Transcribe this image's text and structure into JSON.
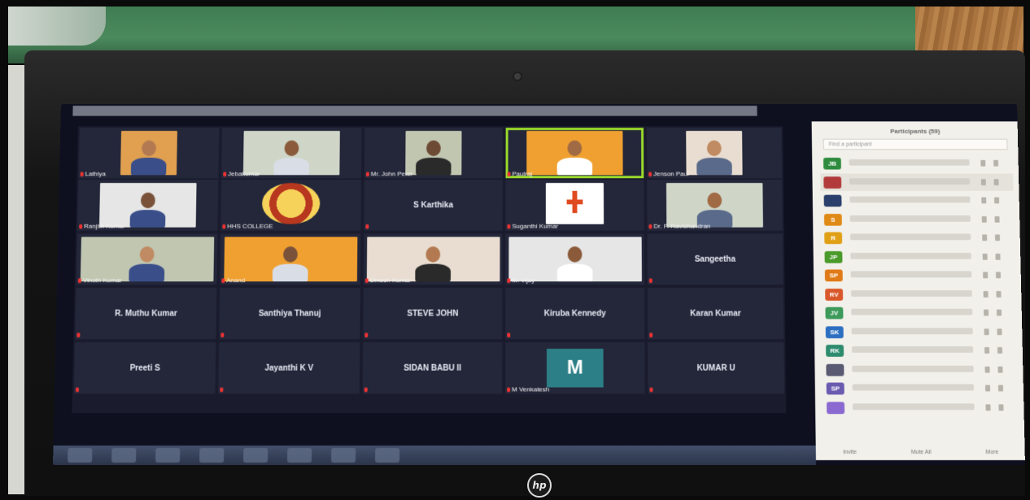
{
  "meeting": {
    "view_label": "",
    "participants_panel_title": "Participants (59)",
    "search_placeholder": "Find a participant",
    "panel_footer": [
      "Invite",
      "Mute All",
      "More"
    ]
  },
  "tiles": [
    {
      "id": "t1",
      "name": "Lathiya",
      "kind": "video",
      "active": false
    },
    {
      "id": "t2",
      "name": "Jebakumar",
      "kind": "video",
      "active": false
    },
    {
      "id": "t3",
      "name": "Mr. John Peter",
      "kind": "video",
      "active": false
    },
    {
      "id": "t4",
      "name": "Paulraj",
      "kind": "video",
      "active": true
    },
    {
      "id": "t5",
      "name": "Jenson Paul",
      "kind": "video",
      "active": false
    },
    {
      "id": "t6",
      "name": "Ranjith Kumar",
      "kind": "video",
      "active": false
    },
    {
      "id": "t7",
      "name": "HHS COLLEGE",
      "kind": "logo",
      "active": false
    },
    {
      "id": "t8",
      "name": "S Karthika",
      "kind": "text",
      "active": false
    },
    {
      "id": "t9",
      "name": "Suganthi Kumar",
      "kind": "logo",
      "active": false
    },
    {
      "id": "t10",
      "name": "Dr. P. Ravichandran",
      "kind": "video",
      "active": false
    },
    {
      "id": "t11",
      "name": "Vinoth Kumar",
      "kind": "video",
      "active": false
    },
    {
      "id": "t12",
      "name": "Anand",
      "kind": "video",
      "active": false
    },
    {
      "id": "t13",
      "name": "Dinesh Kumar",
      "kind": "video",
      "active": false
    },
    {
      "id": "t14",
      "name": "M. Vijay",
      "kind": "video",
      "active": false
    },
    {
      "id": "t15",
      "name": "Sangeetha",
      "kind": "text",
      "active": false
    },
    {
      "id": "t16",
      "name": "R. Muthu Kumar",
      "kind": "text",
      "active": false
    },
    {
      "id": "t17",
      "name": "Santhiya Thanuj",
      "kind": "text",
      "active": false
    },
    {
      "id": "t18",
      "name": "STEVE JOHN",
      "kind": "text",
      "active": false
    },
    {
      "id": "t19",
      "name": "Kiruba Kennedy",
      "kind": "text",
      "active": false
    },
    {
      "id": "t20",
      "name": "Karan Kumar",
      "kind": "text",
      "active": false
    },
    {
      "id": "t21",
      "name": "Preeti S",
      "kind": "text",
      "active": false
    },
    {
      "id": "t22",
      "name": "Jayanthi K V",
      "kind": "text",
      "active": false
    },
    {
      "id": "t23",
      "name": "SIDAN BABU II",
      "kind": "text",
      "active": false
    },
    {
      "id": "t24",
      "name": "M Venkatesh",
      "kind": "avatar",
      "avatar_letter": "M",
      "active": false
    },
    {
      "id": "t25",
      "name": "KUMAR U",
      "kind": "text",
      "active": false
    }
  ],
  "participants_list": [
    {
      "initials": "JB",
      "color": "#2e8b3e"
    },
    {
      "initials": "",
      "color": "#b23a3a"
    },
    {
      "initials": "",
      "color": "#2a3f6b"
    },
    {
      "initials": "S",
      "color": "#e08a16"
    },
    {
      "initials": "R",
      "color": "#e0a016"
    },
    {
      "initials": "JP",
      "color": "#4a9a2a"
    },
    {
      "initials": "SP",
      "color": "#e07a16"
    },
    {
      "initials": "RV",
      "color": "#d9572a"
    },
    {
      "initials": "JV",
      "color": "#3d9a5a"
    },
    {
      "initials": "SK",
      "color": "#2c6fc1"
    },
    {
      "initials": "RK",
      "color": "#2e8b6e"
    },
    {
      "initials": "",
      "color": "#5a5a72"
    },
    {
      "initials": "SP",
      "color": "#6a5ab0"
    },
    {
      "initials": "",
      "color": "#8a6ad0"
    }
  ],
  "colors": {
    "active_speaker_border": "#9bdc2b",
    "gallery_background": "#1a1c2e",
    "tile_background": "#24273a",
    "panel_background": "#f2f0ea"
  },
  "device": {
    "brand_logo_text": "hp"
  }
}
